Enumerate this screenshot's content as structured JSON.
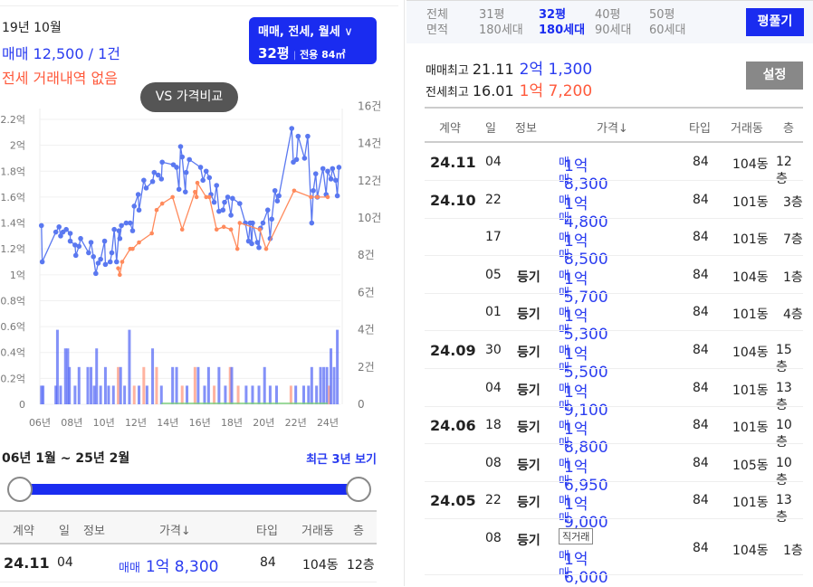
{
  "summary": {
    "month": "19년 10월",
    "sale": "매매 12,500 / 1건",
    "jeonse": "전세 거래내역 없음"
  },
  "filter": {
    "types": "매매, 전세, 월세",
    "pyeong": "32평",
    "exclusive": "전용 84㎡",
    "chevron": "chevron-down-icon"
  },
  "compare_button": "VS 가격비교",
  "chart_data": {
    "type": "line",
    "x_unit": "years since 2000",
    "xticks": [
      "06년",
      "08년",
      "10년",
      "12년",
      "14년",
      "16년",
      "18년",
      "20년",
      "22년",
      "24년"
    ],
    "xtick_values": [
      6,
      8,
      10,
      12,
      14,
      16,
      18,
      20,
      22,
      24
    ],
    "yticks_left": [
      "0",
      "0.2억",
      "0.4억",
      "0.6억",
      "0.8억",
      "1억",
      "1.2억",
      "1.4억",
      "1.6억",
      "1.8억",
      "2억",
      "2.2억"
    ],
    "ylim_left": [
      0,
      2.2
    ],
    "ylabel_left": "억",
    "yticks_right": [
      "0",
      "2건",
      "4건",
      "6건",
      "8건",
      "10건",
      "12건",
      "14건",
      "16건"
    ],
    "ylim_right": [
      0,
      16
    ],
    "ylabel_right": "건",
    "colors": {
      "sale": "#5a78f0",
      "jeonse": "#ff8a5c",
      "rent": "#7ed07e",
      "volume_sale": "#5a6cf5",
      "volume_jeonse": "#ff9a80"
    },
    "series": [
      {
        "name": "매매",
        "points": [
          [
            6.1,
            1.38
          ],
          [
            6.15,
            1.1
          ],
          [
            7.0,
            1.33
          ],
          [
            7.2,
            1.37
          ],
          [
            7.3,
            1.3
          ],
          [
            7.45,
            1.33
          ],
          [
            7.65,
            1.35
          ],
          [
            7.9,
            1.32
          ],
          [
            7.9,
            1.26
          ],
          [
            8.2,
            1.23
          ],
          [
            8.25,
            1.15
          ],
          [
            8.45,
            1.22
          ],
          [
            8.55,
            1.28
          ],
          [
            9.05,
            1.17
          ],
          [
            9.2,
            1.25
          ],
          [
            9.35,
            1.14
          ],
          [
            9.5,
            1.01
          ],
          [
            9.65,
            1.09
          ],
          [
            9.8,
            1.12
          ],
          [
            10.05,
            1.26
          ],
          [
            10.1,
            1.08
          ],
          [
            10.4,
            1.1
          ],
          [
            10.5,
            1.17
          ],
          [
            10.65,
            1.35
          ],
          [
            10.8,
            1.1
          ],
          [
            10.95,
            1.34
          ],
          [
            11.0,
            1.28
          ],
          [
            11.1,
            1.38
          ],
          [
            11.4,
            1.4
          ],
          [
            11.65,
            1.4
          ],
          [
            11.8,
            1.34
          ],
          [
            11.9,
            1.53
          ],
          [
            12.15,
            1.62
          ],
          [
            12.2,
            1.5
          ],
          [
            12.5,
            1.73
          ],
          [
            12.65,
            1.67
          ],
          [
            13.05,
            1.72
          ],
          [
            13.15,
            1.79
          ],
          [
            13.4,
            1.77
          ],
          [
            13.6,
            1.74
          ],
          [
            13.65,
            1.87
          ],
          [
            14.35,
            1.85
          ],
          [
            14.55,
            1.83
          ],
          [
            14.7,
            1.66
          ],
          [
            14.8,
            1.99
          ],
          [
            14.9,
            1.91
          ],
          [
            15.1,
            1.64
          ],
          [
            15.15,
            1.79
          ],
          [
            15.35,
            1.89
          ],
          [
            16.05,
            1.83
          ],
          [
            16.2,
            1.73
          ],
          [
            16.4,
            1.8
          ],
          [
            16.6,
            1.75
          ],
          [
            16.7,
            1.62
          ],
          [
            16.9,
            1.56
          ],
          [
            17.05,
            1.69
          ],
          [
            17.2,
            1.49
          ],
          [
            17.45,
            1.5
          ],
          [
            17.55,
            1.56
          ],
          [
            17.75,
            1.6
          ],
          [
            17.95,
            1.46
          ],
          [
            18.05,
            1.59
          ],
          [
            18.5,
            1.55
          ],
          [
            18.85,
            1.4
          ],
          [
            19.05,
            1.26
          ],
          [
            19.15,
            1.4
          ],
          [
            19.25,
            1.24
          ],
          [
            19.3,
            1.4
          ],
          [
            19.6,
            1.25
          ],
          [
            19.7,
            1.21
          ],
          [
            19.8,
            1.36
          ],
          [
            19.95,
            1.4
          ],
          [
            20.25,
            1.5
          ],
          [
            20.4,
            1.28
          ],
          [
            20.5,
            1.43
          ],
          [
            20.7,
            1.65
          ],
          [
            20.85,
            1.57
          ],
          [
            20.95,
            1.61
          ],
          [
            21.75,
            2.13
          ],
          [
            21.85,
            1.87
          ],
          [
            22.05,
            1.89
          ],
          [
            22.15,
            2.07
          ],
          [
            22.55,
            1.9
          ],
          [
            22.75,
            2.07
          ],
          [
            23.0,
            1.4
          ],
          [
            23.1,
            1.65
          ],
          [
            23.25,
            1.78
          ],
          [
            23.35,
            1.6
          ],
          [
            23.7,
            1.82
          ],
          [
            23.9,
            1.62
          ],
          [
            24.0,
            1.8
          ],
          [
            24.2,
            1.74
          ],
          [
            24.3,
            1.82
          ],
          [
            24.5,
            1.73
          ],
          [
            24.6,
            1.61
          ],
          [
            24.7,
            1.83
          ]
        ]
      },
      {
        "name": "전세",
        "points": [
          [
            10.9,
            1.05
          ],
          [
            11.0,
            1.0
          ],
          [
            11.15,
            1.1
          ],
          [
            11.65,
            1.2
          ],
          [
            11.8,
            1.2
          ],
          [
            12.2,
            1.25
          ],
          [
            13.0,
            1.32
          ],
          [
            13.3,
            1.5
          ],
          [
            13.65,
            1.55
          ],
          [
            14.3,
            1.6
          ],
          [
            14.9,
            1.35
          ],
          [
            15.7,
            1.64
          ],
          [
            15.8,
            1.6
          ],
          [
            15.85,
            1.71
          ],
          [
            16.4,
            1.6
          ],
          [
            16.6,
            1.6
          ],
          [
            17.05,
            1.35
          ],
          [
            17.5,
            1.37
          ],
          [
            17.95,
            1.35
          ],
          [
            18.35,
            1.2
          ],
          [
            18.5,
            1.4
          ],
          [
            19.75,
            1.35
          ],
          [
            20.15,
            1.2
          ],
          [
            21.9,
            1.65
          ],
          [
            22.95,
            1.6
          ],
          [
            23.35,
            1.6
          ],
          [
            24.0,
            1.6
          ]
        ]
      }
    ],
    "volume": [
      [
        6.1,
        1,
        "매매"
      ],
      [
        6.2,
        1,
        "매매"
      ],
      [
        7.0,
        1,
        "매매"
      ],
      [
        7.1,
        4,
        "매매"
      ],
      [
        7.3,
        1,
        "매매"
      ],
      [
        7.6,
        3,
        "매매"
      ],
      [
        7.75,
        3,
        "매매"
      ],
      [
        7.85,
        2,
        "매매"
      ],
      [
        8.2,
        1,
        "매매"
      ],
      [
        8.45,
        2,
        "매매"
      ],
      [
        9.0,
        2,
        "매매"
      ],
      [
        9.2,
        2,
        "매매"
      ],
      [
        9.4,
        1,
        "매매"
      ],
      [
        9.55,
        3,
        "매매"
      ],
      [
        9.8,
        1,
        "매매"
      ],
      [
        10.1,
        2,
        "매매"
      ],
      [
        10.3,
        1,
        "매매"
      ],
      [
        10.6,
        1,
        "매매"
      ],
      [
        10.9,
        2,
        "전세"
      ],
      [
        11.05,
        2,
        "매매"
      ],
      [
        11.3,
        1,
        "매매"
      ],
      [
        11.6,
        4,
        "매매"
      ],
      [
        11.9,
        1,
        "전세"
      ],
      [
        12.2,
        1,
        "매매"
      ],
      [
        12.5,
        2,
        "전세"
      ],
      [
        12.7,
        1,
        "매매"
      ],
      [
        13.05,
        3,
        "매매"
      ],
      [
        13.3,
        2,
        "전세"
      ],
      [
        13.6,
        1,
        "매매"
      ],
      [
        14.3,
        2,
        "매매"
      ],
      [
        14.55,
        2,
        "매매"
      ],
      [
        14.9,
        1,
        "전세"
      ],
      [
        15.2,
        1,
        "매매"
      ],
      [
        15.7,
        2,
        "전세"
      ],
      [
        15.9,
        2,
        "매매"
      ],
      [
        16.3,
        1,
        "매매"
      ],
      [
        16.55,
        2,
        "매매"
      ],
      [
        16.9,
        1,
        "전세"
      ],
      [
        17.2,
        2,
        "매매"
      ],
      [
        17.6,
        1,
        "매매"
      ],
      [
        17.9,
        2,
        "전세"
      ],
      [
        18.0,
        2,
        "매매"
      ],
      [
        18.4,
        1,
        "전세"
      ],
      [
        18.9,
        1,
        "매매"
      ],
      [
        19.3,
        1,
        "매매"
      ],
      [
        19.7,
        1,
        "매매"
      ],
      [
        20.05,
        2,
        "매매"
      ],
      [
        20.4,
        1,
        "매매"
      ],
      [
        20.8,
        1,
        "매매"
      ],
      [
        21.7,
        1,
        "전세"
      ],
      [
        22.0,
        1,
        "매매"
      ],
      [
        22.5,
        1,
        "매매"
      ],
      [
        22.8,
        1,
        "매매"
      ],
      [
        23.0,
        2,
        "매매"
      ],
      [
        23.3,
        1,
        "매매"
      ],
      [
        23.55,
        2,
        "매매"
      ],
      [
        23.75,
        2,
        "매매"
      ],
      [
        23.95,
        2,
        "매매"
      ],
      [
        24.1,
        1,
        "전세"
      ],
      [
        24.2,
        3,
        "매매"
      ],
      [
        24.4,
        2,
        "매매"
      ],
      [
        24.6,
        4,
        "매매"
      ]
    ],
    "rent_line": [
      [
        13.6,
        0
      ],
      [
        24.0,
        0
      ]
    ]
  },
  "range": {
    "label": "06년 1월 ~ 25년 2월",
    "recent": "최근 3년 보기",
    "start_fraction": 0,
    "end_fraction": 1
  },
  "table_headers": {
    "contract": "계약",
    "day": "일",
    "info": "정보",
    "price": "가격↓",
    "type": "타입",
    "dong": "거래동",
    "floor": "층"
  },
  "left_row": {
    "contract": "24.11",
    "day": "04",
    "kind": "매매",
    "price": "1억 8,300",
    "type": "84",
    "dong": "104동",
    "floor": "12층"
  },
  "areas": [
    {
      "top": "전체",
      "bottom": "면적"
    },
    {
      "top": "31평",
      "bottom": "180세대"
    },
    {
      "top": "32평",
      "bottom": "180세대"
    },
    {
      "top": "40평",
      "bottom": "90세대"
    },
    {
      "top": "50평",
      "bottom": "60세대"
    }
  ],
  "pyeong_button": "평풀기",
  "max": {
    "sale_label": "매매최고",
    "sale_date": "21.11",
    "sale_price": "2억 1,300",
    "jeonse_label": "전세최고",
    "jeonse_date": "16.01",
    "jeonse_price": "1억 7,200"
  },
  "settings_button": "설정",
  "rows": [
    {
      "contract": "24.11",
      "day": "04",
      "info": "",
      "kind": "매매",
      "price": "1억 8,300",
      "type": "84",
      "dong": "104동",
      "floor": "12층"
    },
    {
      "contract": "24.10",
      "day": "22",
      "info": "",
      "kind": "매매",
      "price": "1억 4,800",
      "type": "84",
      "dong": "101동",
      "floor": "3층"
    },
    {
      "contract": "",
      "day": "17",
      "info": "",
      "kind": "매매",
      "price": "1억 8,500",
      "type": "84",
      "dong": "101동",
      "floor": "7층"
    },
    {
      "contract": "",
      "day": "05",
      "info": "등기",
      "kind": "매매",
      "price": "1억 5,700",
      "type": "84",
      "dong": "104동",
      "floor": "1층"
    },
    {
      "contract": "",
      "day": "01",
      "info": "등기",
      "kind": "매매",
      "price": "1억 5,300",
      "type": "84",
      "dong": "101동",
      "floor": "4층"
    },
    {
      "contract": "24.09",
      "day": "30",
      "info": "등기",
      "kind": "매매",
      "price": "1억 5,500",
      "type": "84",
      "dong": "104동",
      "floor": "15층"
    },
    {
      "contract": "",
      "day": "04",
      "info": "등기",
      "kind": "매매",
      "price": "1억 9,100",
      "type": "84",
      "dong": "101동",
      "floor": "13층"
    },
    {
      "contract": "24.06",
      "day": "18",
      "info": "등기",
      "kind": "매매",
      "price": "1억 8,800",
      "type": "84",
      "dong": "101동",
      "floor": "10층"
    },
    {
      "contract": "",
      "day": "08",
      "info": "등기",
      "kind": "매매",
      "price": "1억 6,950",
      "type": "84",
      "dong": "105동",
      "floor": "10층"
    },
    {
      "contract": "24.05",
      "day": "22",
      "info": "등기",
      "kind": "매매",
      "price": "1억 9,000",
      "type": "84",
      "dong": "101동",
      "floor": "13층"
    },
    {
      "contract": "",
      "day": "08",
      "info": "등기",
      "tag": "직거래",
      "kind": "매매",
      "price": "1억 6,000",
      "type": "84",
      "dong": "104동",
      "floor": "1층"
    }
  ]
}
